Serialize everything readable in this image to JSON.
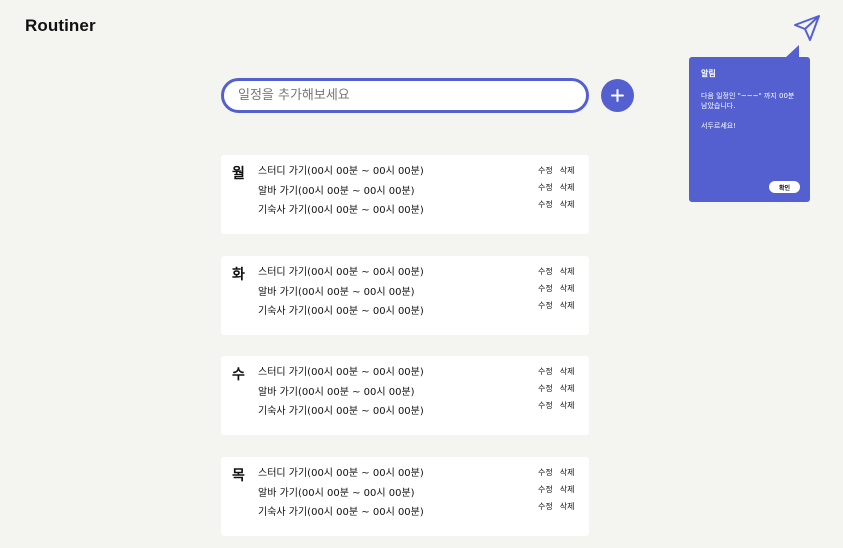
{
  "header": {
    "title": "Routiner",
    "send_icon": "paper-plane-icon"
  },
  "add_form": {
    "placeholder": "일정을 추가해보세요",
    "add_icon": "plus-icon"
  },
  "actions": {
    "edit": "수정",
    "delete": "삭제"
  },
  "days": [
    {
      "label": "월",
      "items": [
        "스터디 가기(00시 00분 ~ 00시 00분)",
        "알바 가기(00시 00분 ~ 00시 00분)",
        "기숙사 가기(00시 00분 ~ 00시 00분)"
      ]
    },
    {
      "label": "화",
      "items": [
        "스터디 가기(00시 00분 ~ 00시 00분)",
        "알바 가기(00시 00분 ~ 00시 00분)",
        "기숙사 가기(00시 00분 ~ 00시 00분)"
      ]
    },
    {
      "label": "수",
      "items": [
        "스터디 가기(00시 00분 ~ 00시 00분)",
        "알바 가기(00시 00분 ~ 00시 00분)",
        "기숙사 가기(00시 00분 ~ 00시 00분)"
      ]
    },
    {
      "label": "목",
      "items": [
        "스터디 가기(00시 00분 ~ 00시 00분)",
        "알바 가기(00시 00분 ~ 00시 00분)",
        "기숙사 가기(00시 00분 ~ 00시 00분)"
      ]
    }
  ],
  "notification": {
    "title": "알림",
    "message": "다음 일정인 \"~~~\" 까지 00분 남았습니다.",
    "extra": "서두르세요!",
    "confirm_label": "확인"
  },
  "colors": {
    "accent": "#5560d0",
    "background": "#f4f4f0",
    "card": "#ffffff"
  }
}
